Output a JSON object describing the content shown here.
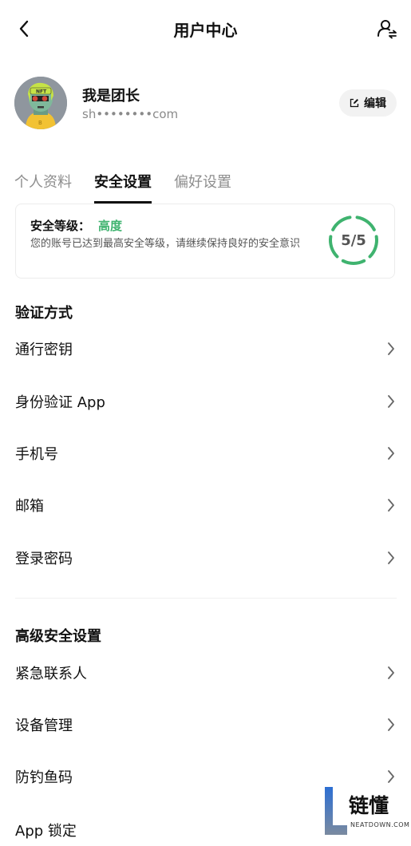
{
  "header": {
    "title": "用户中心",
    "back_icon": "chevron-left-icon",
    "switch_icon": "user-switch-icon"
  },
  "profile": {
    "username": "我是团长",
    "email": "sh••••••••com",
    "edit_label": "编辑",
    "edit_icon": "edit-icon"
  },
  "tabs": [
    {
      "label": "个人资料",
      "active": false
    },
    {
      "label": "安全设置",
      "active": true
    },
    {
      "label": "偏好设置",
      "active": false
    }
  ],
  "security": {
    "level_label": "安全等级：",
    "level_value": "高度",
    "description": "您的账号已达到最高安全等级，请继续保持良好的安全意识",
    "score_text": "5/5",
    "score_fraction": 1.0,
    "accent_color": "#3fb36f"
  },
  "sections": [
    {
      "title": "验证方式",
      "items": [
        "通行密钥",
        "身份验证 App",
        "手机号",
        "邮箱",
        "登录密码"
      ]
    },
    {
      "title": "高级安全设置",
      "items": [
        "紧急联系人",
        "设备管理",
        "防钓鱼码",
        "App 锁定"
      ]
    }
  ],
  "watermark": {
    "brand": "链懂",
    "sub": "NEATDOWN.COM"
  }
}
